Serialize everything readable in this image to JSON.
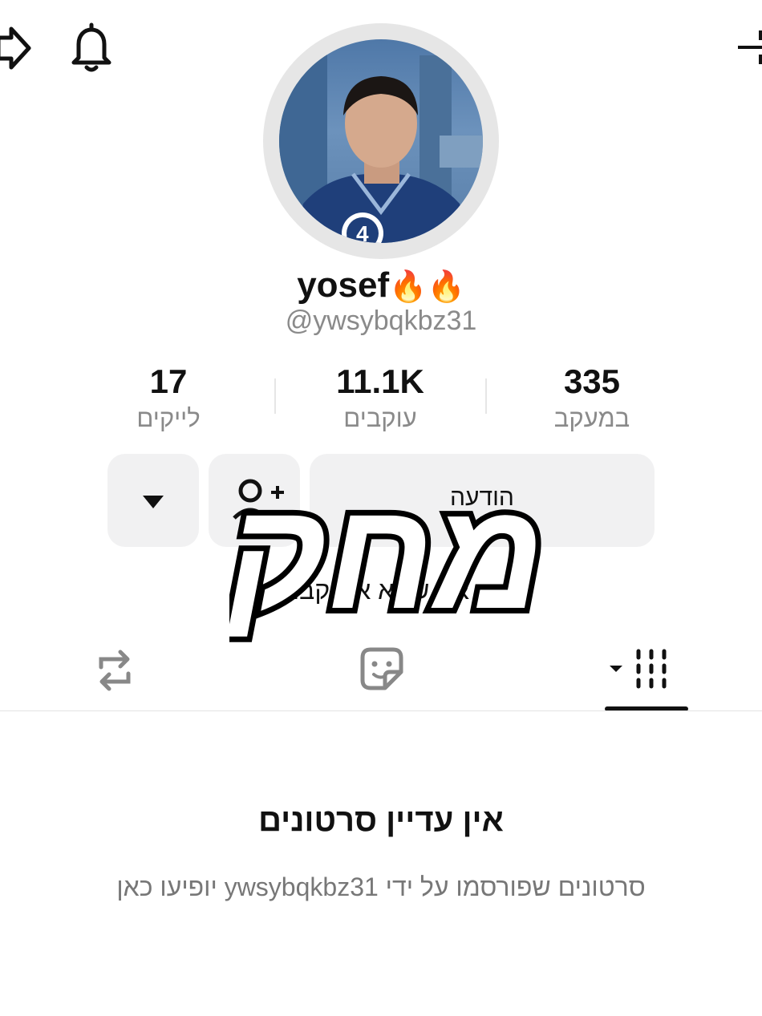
{
  "profile": {
    "display_name": "yosef",
    "display_emoji": "🔥🔥",
    "username": "@ywsybqkbz31",
    "bio": "אני שונא את קבו"
  },
  "stats": {
    "likes": {
      "value": "17",
      "label": "לייקים"
    },
    "followers": {
      "value": "11.1K",
      "label": "עוקבים"
    },
    "following": {
      "value": "335",
      "label": "במעקב"
    }
  },
  "actions": {
    "message_label": "הודעה"
  },
  "tabs": [
    "videos",
    "liked",
    "reposts"
  ],
  "empty_state": {
    "title": "אין עדיין סרטונים",
    "subtitle": "סרטונים שפורסמו על ידי ywsybqkbz31 יופיעו כאן"
  },
  "overlay": {
    "text": "מחק"
  },
  "icons": {
    "share": "share-arrow-icon",
    "notifications": "bell-icon",
    "menu": "menu-icon",
    "more": "caret-down-icon",
    "add_user": "add-user-icon",
    "videos_tab": "grid-icon",
    "liked_tab": "sticker-icon",
    "repost_tab": "repost-icon"
  },
  "colors": {
    "text": "#111111",
    "muted": "#8a8a8a",
    "button_bg": "#f1f1f2",
    "avatar_ring": "#e6e6e6"
  }
}
